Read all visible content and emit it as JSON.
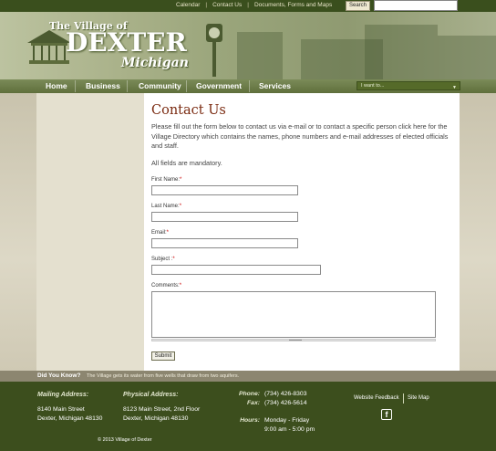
{
  "topbar": {
    "links": [
      "Calendar",
      "Contact Us",
      "Documents, Forms and Maps"
    ],
    "search_button": "Search",
    "search_placeholder": ""
  },
  "logo": {
    "line1": "The Village of",
    "line2": "DEXTER",
    "line3": "Michigan"
  },
  "nav": {
    "items": [
      "Home",
      "Business",
      "Community",
      "Government",
      "Services"
    ],
    "dropdown_label": "I want to...",
    "dropdown_icon": "chevron-down-icon"
  },
  "main": {
    "title": "Contact Us",
    "intro": "Please fill out the form below to contact us via e-mail or to contact a specific person click here for the Village Directory which contains the names, phone numbers and e-mail addresses of elected officials and staff.",
    "mandatory": "All fields are mandatory.",
    "fields": [
      {
        "label": "First Name:",
        "req": "*",
        "value": ""
      },
      {
        "label": "Last Name:",
        "req": "*",
        "value": ""
      },
      {
        "label": "Email:",
        "req": "*",
        "value": ""
      },
      {
        "label": "Subject :",
        "req": "*",
        "value": ""
      },
      {
        "label": "Comments:",
        "req": "*",
        "value": ""
      }
    ],
    "submit_label": "Submit"
  },
  "did_you_know": {
    "title": "Did You Know?",
    "text": "The Village gets its water from five wells that draw from two aquifers."
  },
  "footer": {
    "mailing_heading": "Mailing Address:",
    "mailing_line1": "8140 Main Street",
    "mailing_line2": "Dexter, Michigan 48130",
    "physical_heading": "Physical Address:",
    "physical_line1": "8123 Main Street, 2nd Floor",
    "physical_line2": "Dexter, Michigan 48130",
    "phone_label": "Phone:",
    "phone_value": "(734) 426-8303",
    "fax_label": "Fax:",
    "fax_value": "(734) 426-5614",
    "hours_label": "Hours:",
    "hours_line1": "Monday - Friday",
    "hours_line2": "9:00 am - 5:00 pm",
    "feedback_link": "Website Feedback",
    "sitemap_link": "Site Map",
    "social_icon": "facebook-icon",
    "social_glyph": "f",
    "copyright": "© 2013 Village of Dexter"
  },
  "colors": {
    "brand_green": "#3c4e1d",
    "title_red": "#7a2a10",
    "background": "#d2ccb8"
  }
}
